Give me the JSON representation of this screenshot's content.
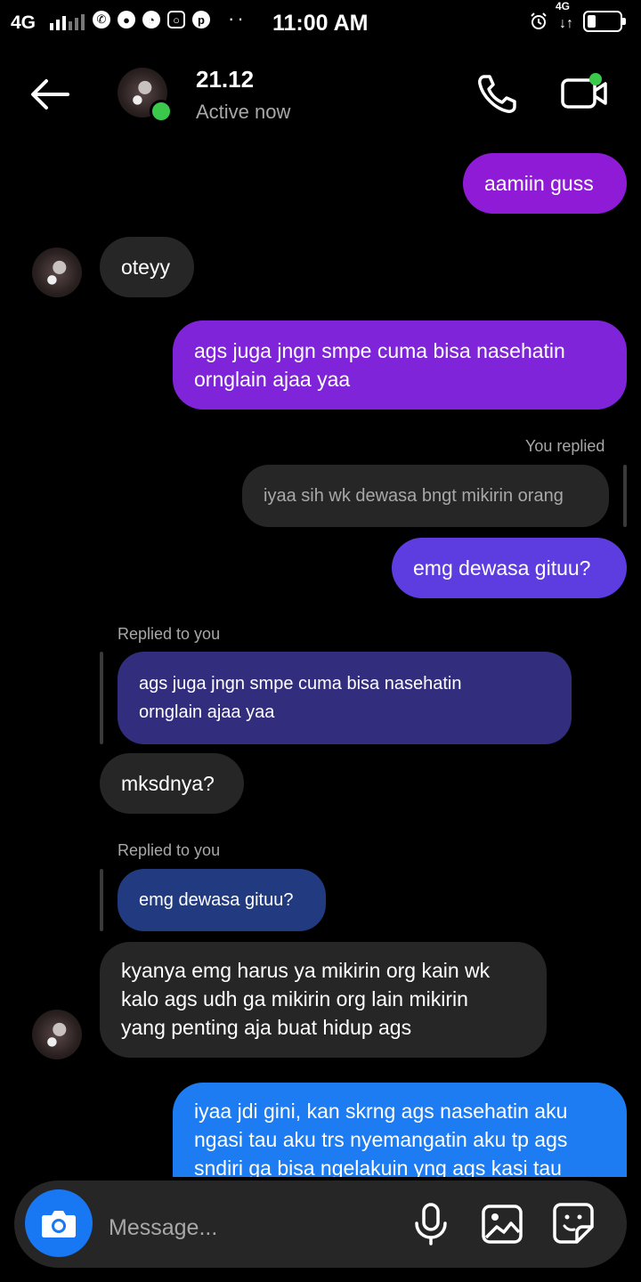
{
  "status_bar": {
    "network": "4G",
    "network_small": "4G",
    "time": "11:00 AM",
    "icons": [
      "signal-icon",
      "whatsapp-icon",
      "messenger-icon",
      "speedometer-icon",
      "instagram-icon",
      "pinterest-icon",
      "alarm-icon",
      "data-arrows-icon",
      "battery-icon"
    ]
  },
  "header": {
    "contact_name": "21.12",
    "status": "Active now",
    "colors": {
      "online": "#3ac94a"
    }
  },
  "messages": [
    {
      "from": "me",
      "text": "aamiin guss"
    },
    {
      "from": "them",
      "text": "oteyy"
    },
    {
      "from": "me",
      "lines": [
        "ags juga jngn smpe cuma bisa nasehatin",
        "ornglain ajaa yaa"
      ]
    },
    {
      "from": "me",
      "reply_label": "You replied",
      "quoted": "iyaa sih wk dewasa bngt mikirin orang",
      "text": "emg dewasa gituu?"
    },
    {
      "from": "them",
      "reply_label": "Replied to you",
      "quoted_lines": [
        "ags juga jngn smpe cuma bisa nasehatin",
        "ornglain ajaa yaa"
      ],
      "text": "mksdnya?"
    },
    {
      "from": "them",
      "reply_label": "Replied to you",
      "quoted": "emg dewasa gituu?",
      "lines": [
        "kyanya emg harus ya mikirin org kain wk",
        "kalo ags udh ga mikirin org lain mikirin",
        "yang penting aja buat hidup ags"
      ]
    },
    {
      "from": "me",
      "lines": [
        "iyaa jdi gini, kan skrng ags nasehatin aku",
        "ngasi tau aku trs nyemangatin aku tp ags",
        "sndiri ga bisa ngelakuin yng ags kasi tau"
      ]
    }
  ],
  "composer": {
    "placeholder": "Message...",
    "accent": "#1877f2"
  },
  "theme": {
    "background": "#000000",
    "incoming_bubble": "#262626",
    "outgoing_gradient": [
      "#9b1ad3",
      "#5a3fe0",
      "#1d7cf2"
    ]
  }
}
